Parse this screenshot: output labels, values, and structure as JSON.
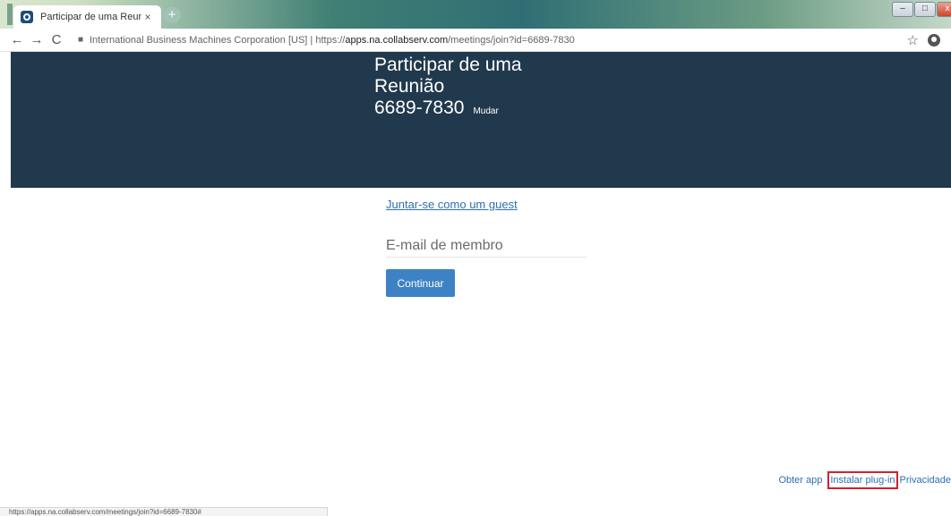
{
  "browser": {
    "tab": {
      "title": "Participar de uma Reunião",
      "close_glyph": "×"
    },
    "new_tab_glyph": "+",
    "window_controls": {
      "minimize": "–",
      "maximize": "□",
      "close": "x"
    },
    "nav": {
      "back": "←",
      "forward": "→",
      "reload": "C"
    },
    "address": {
      "owner": "International Business Machines Corporation [US]",
      "separator": "|",
      "scheme": "https://",
      "host": "apps.na.collabserv.com",
      "path": "/meetings/join?id=6689-7830"
    },
    "star_glyph": "☆",
    "icons": [
      "favicon-icon",
      "back-icon",
      "forward-icon",
      "reload-icon",
      "lock-icon",
      "star-icon",
      "profile-icon"
    ]
  },
  "page": {
    "banner": {
      "title": "Participar de uma Reunião",
      "meeting_id": "6689-7830",
      "change_link": "Mudar"
    },
    "guest_link": "Juntar-se como um guest",
    "email": {
      "placeholder": "E-mail de membro",
      "value": ""
    },
    "continue_button": "Continuar",
    "footer": {
      "get_app": "Obter app",
      "install_plugin": "Instalar plug-in",
      "privacy": "Privacidade"
    }
  },
  "status_bar": {
    "url": "https://apps.na.collabserv.com/meetings/join?id=6689-7830#"
  },
  "colors": {
    "banner": "#21394d",
    "link": "#2d6fb4",
    "button": "#3d82c4",
    "highlight": "#d2222a"
  }
}
